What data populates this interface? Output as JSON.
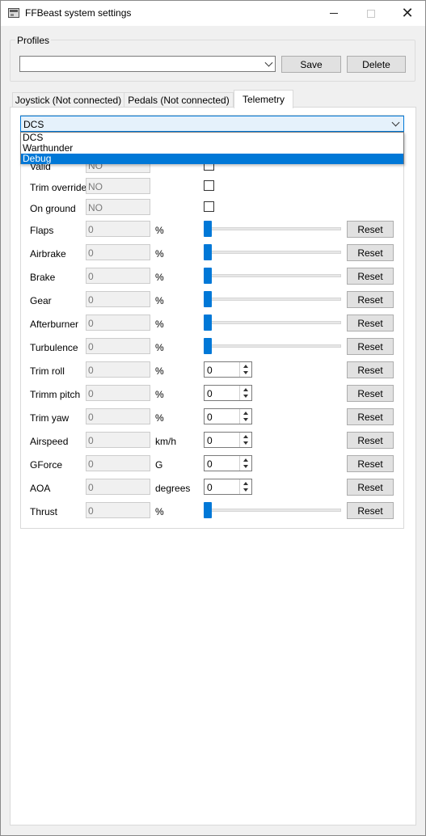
{
  "window": {
    "title": "FFBeast system settings",
    "close_glyph": "✕",
    "icons": [
      "app-icon",
      "minimize-icon",
      "maximize-icon",
      "close-icon"
    ]
  },
  "profiles": {
    "group_title": "Profiles",
    "selected": "",
    "save_label": "Save",
    "delete_label": "Delete"
  },
  "tabs": [
    {
      "label": "Joystick (Not connected)",
      "active": false
    },
    {
      "label": "Pedals (Not connected)",
      "active": false
    },
    {
      "label": "Telemetry",
      "active": true
    }
  ],
  "telemetry": {
    "sim_selected": "DCS",
    "sim_options": [
      "DCS",
      "Warthunder",
      "Debug"
    ],
    "highlighted_option": "Debug",
    "status_rows": [
      {
        "label": "Valid",
        "value": "NO"
      },
      {
        "label": "Trim override",
        "value": "NO"
      },
      {
        "label": "On ground",
        "value": "NO"
      }
    ],
    "slider_rows": [
      {
        "label": "Flaps",
        "value": "0",
        "unit": "%",
        "level": 0
      },
      {
        "label": "Airbrake",
        "value": "0",
        "unit": "%",
        "level": 0
      },
      {
        "label": "Brake",
        "value": "0",
        "unit": "%",
        "level": 0
      },
      {
        "label": "Gear",
        "value": "0",
        "unit": "%",
        "level": 0
      },
      {
        "label": "Afterburner",
        "value": "0",
        "unit": "%",
        "level": 0
      },
      {
        "label": "Turbulence",
        "value": "0",
        "unit": "%",
        "level": 0
      }
    ],
    "spin_rows": [
      {
        "label": "Trim roll",
        "value": "0",
        "unit": "%",
        "setting": "0"
      },
      {
        "label": "Trimm pitch",
        "value": "0",
        "unit": "%",
        "setting": "0"
      },
      {
        "label": "Trim yaw",
        "value": "0",
        "unit": "%",
        "setting": "0"
      },
      {
        "label": "Airspeed",
        "value": "0",
        "unit": "km/h",
        "setting": "0"
      },
      {
        "label": "GForce",
        "value": "0",
        "unit": "G",
        "setting": "0"
      },
      {
        "label": "AOA",
        "value": "0",
        "unit": "degrees",
        "setting": "0"
      }
    ],
    "thrust_row": {
      "label": "Thrust",
      "value": "0",
      "unit": "%",
      "level": 0
    },
    "reset_label": "Reset"
  },
  "colors": {
    "accent": "#0078d7",
    "combo_highlight": "#e5f1fb",
    "window_bg": "#f0f0f0",
    "button_bg": "#e1e1e1"
  }
}
